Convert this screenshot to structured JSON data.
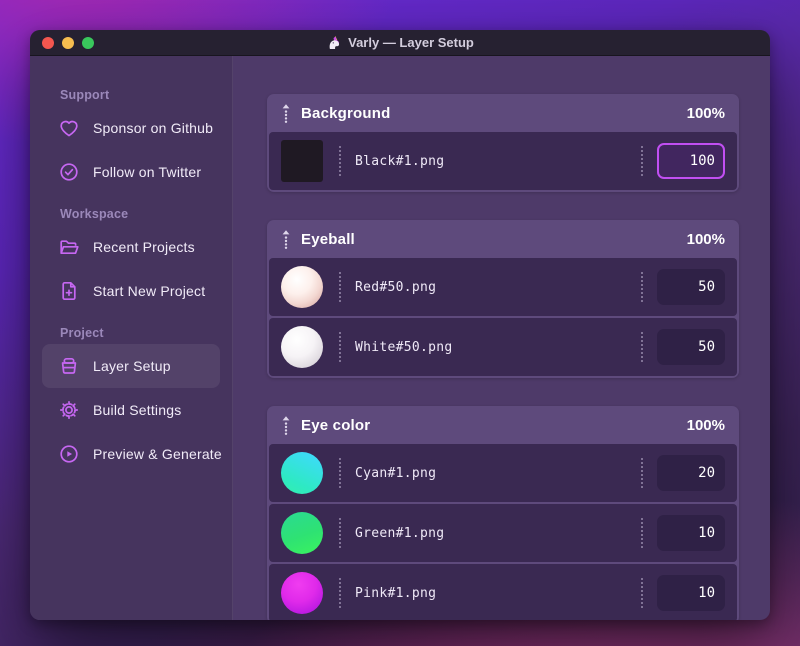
{
  "window": {
    "title": "Varly — Layer Setup"
  },
  "sidebar": {
    "sections": [
      {
        "heading": "Support",
        "items": [
          {
            "label": "Sponsor on Github",
            "icon": "heart-icon"
          },
          {
            "label": "Follow on Twitter",
            "icon": "badge-check-icon"
          }
        ]
      },
      {
        "heading": "Workspace",
        "items": [
          {
            "label": "Recent Projects",
            "icon": "folder-open-icon"
          },
          {
            "label": "Start New Project",
            "icon": "file-plus-icon"
          }
        ]
      },
      {
        "heading": "Project",
        "items": [
          {
            "label": "Layer Setup",
            "icon": "archive-box-icon",
            "active": true
          },
          {
            "label": "Build Settings",
            "icon": "gear-icon"
          },
          {
            "label": "Preview & Generate",
            "icon": "play-circle-icon"
          }
        ]
      }
    ]
  },
  "main": {
    "groups": [
      {
        "name": "Background",
        "opacity": "100%",
        "rows": [
          {
            "filename": "Black#1.png",
            "value": "100",
            "focused": true,
            "thumb": {
              "shape": "square",
              "css": "#1f1923"
            }
          }
        ]
      },
      {
        "name": "Eyeball",
        "opacity": "100%",
        "rows": [
          {
            "filename": "Red#50.png",
            "value": "50",
            "thumb": {
              "shape": "circle",
              "css": "radial-gradient(circle at 38% 32%, #ffffff 0%, #fdf0ec 38%, #f3d8d2 62%, #dfb4ae 85%, #c9938d 100%)"
            }
          },
          {
            "filename": "White#50.png",
            "value": "50",
            "thumb": {
              "shape": "circle",
              "css": "radial-gradient(circle at 38% 32%, #ffffff 0%, #f6f3f6 45%, #ded9df 76%, #c0bac4 100%)"
            }
          }
        ]
      },
      {
        "name": "Eye color",
        "opacity": "100%",
        "rows": [
          {
            "filename": "Cyan#1.png",
            "value": "20",
            "thumb": {
              "shape": "circle",
              "css": "linear-gradient(205deg, #3cdcf4 15%, #2ee9c4 70%, #33efac 100%)"
            }
          },
          {
            "filename": "Green#1.png",
            "value": "10",
            "thumb": {
              "shape": "circle",
              "css": "linear-gradient(160deg, #2bd994 0%, #2ee273 55%, #3bf35e 100%)"
            }
          },
          {
            "filename": "Pink#1.png",
            "value": "10",
            "thumb": {
              "shape": "circle",
              "css": "radial-gradient(circle at 42% 30%, #f03cf0 0%, #e02aea 45%, #b517e0 85%, #9c10d4 100%)"
            }
          }
        ]
      }
    ]
  },
  "colors": {
    "accent_icon": "#c667f2",
    "focus_border": "#c14ff2",
    "group_header_bg": "#5e4a7c",
    "row_bg": "#3a2952",
    "sidebar_bg": "#46345e",
    "main_bg": "#4e3a69",
    "titlebar_bg": "#262131",
    "traffic_red": "#f4564f",
    "traffic_yellow": "#f6bd4f",
    "traffic_green": "#39c75c"
  }
}
